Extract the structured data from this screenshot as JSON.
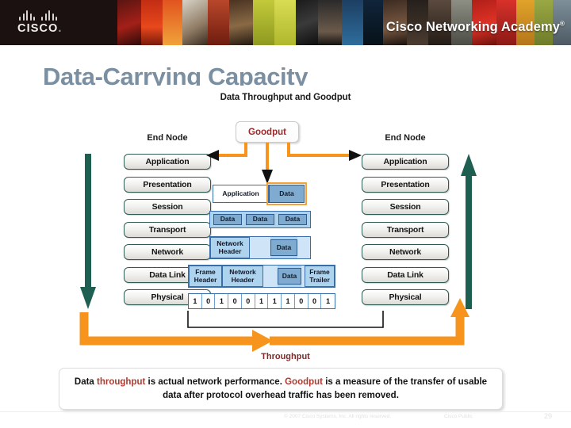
{
  "banner": {
    "logo_word": "CISCO",
    "logo_dot": ".",
    "academy_text": "Cisco Networking Academy",
    "academy_mark": "®"
  },
  "slide": {
    "title": "Data-Carrying Capacity"
  },
  "figure": {
    "title": "Data Throughput and Goodput",
    "end_node_left": "End Node",
    "end_node_right": "End Node",
    "goodput_label": "Goodput",
    "throughput_label": "Throughput",
    "layers_left": [
      "Application",
      "Presentation",
      "Session",
      "Transport",
      "Network",
      "Data Link",
      "Physical"
    ],
    "layers_right": [
      "Application",
      "Presentation",
      "Session",
      "Transport",
      "Network",
      "Data Link",
      "Physical"
    ],
    "encapsulation": [
      {
        "row": "application",
        "cells": [
          {
            "label": "Application",
            "style": "white"
          },
          {
            "label": "Data",
            "style": "data"
          }
        ]
      },
      {
        "row": "segments",
        "cells": [
          {
            "label": "Data",
            "style": "data"
          },
          {
            "label": "Data",
            "style": "data"
          },
          {
            "label": "Data",
            "style": "data"
          }
        ]
      },
      {
        "row": "packet",
        "cells": [
          {
            "label": "Network Header",
            "style": "hdr"
          },
          {
            "label": "",
            "style": "pad"
          },
          {
            "label": "Data",
            "style": "data"
          },
          {
            "label": "",
            "style": "pad"
          }
        ]
      },
      {
        "row": "frame",
        "cells": [
          {
            "label": "Frame Header",
            "style": "hdr"
          },
          {
            "label": "Network Header",
            "style": "hdr"
          },
          {
            "label": "",
            "style": "pad"
          },
          {
            "label": "Data",
            "style": "data"
          },
          {
            "label": "",
            "style": "pad"
          },
          {
            "label": "Frame Trailer",
            "style": "hdr"
          }
        ]
      }
    ],
    "bits": [
      "1",
      "0",
      "1",
      "0",
      "0",
      "1",
      "1",
      "1",
      "0",
      "0",
      "1"
    ]
  },
  "caption": {
    "part1": "Data ",
    "kw1": "throughput",
    "part2": " is actual network performance. ",
    "kw2": "Goodput",
    "part3": " is a measure of the transfer of usable data after protocol overhead traffic has been removed."
  },
  "footer": {
    "copyright": "© 2007 Cisco Systems, Inc. All rights reserved.",
    "classification": "Cisco Public",
    "page_number": "29"
  },
  "colors": {
    "banner_bg": "#1a1110",
    "title_blue_gray": "#7b8fa3",
    "layer_border_green": "#2e5c54",
    "arrow_green": "#1f5f52",
    "accent_orange": "#f7941e",
    "highlight_orange": "#f2a23c",
    "data_blue": "#7fabd0",
    "light_blue": "#aed3ef",
    "keyword_red": "#b03a2e"
  }
}
